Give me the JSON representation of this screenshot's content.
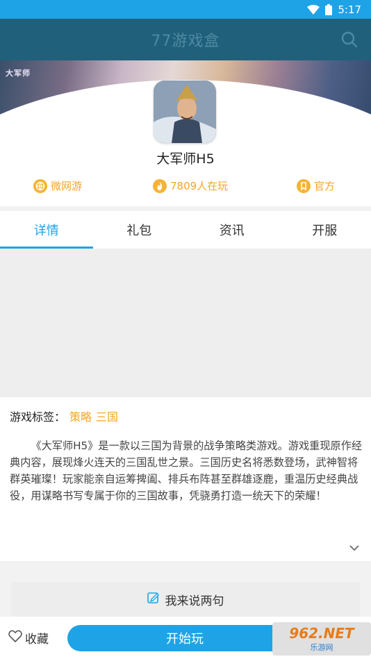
{
  "status_bar": {
    "time": "5:17"
  },
  "header": {
    "title": "77游戏盒"
  },
  "banner": {
    "brand_text": "大军师"
  },
  "game": {
    "name": "大军师H5",
    "meta": [
      {
        "icon": "globe-icon",
        "label": "微网游"
      },
      {
        "icon": "fire-icon",
        "label": "7809人在玩"
      },
      {
        "icon": "bookmark-icon",
        "label": "官方"
      }
    ]
  },
  "tabs": [
    {
      "label": "详情",
      "active": true
    },
    {
      "label": "礼包",
      "active": false
    },
    {
      "label": "资讯",
      "active": false
    },
    {
      "label": "开服",
      "active": false
    }
  ],
  "details": {
    "tags_label": "游戏标签：",
    "tags": [
      "策略",
      "三国"
    ],
    "description": "《大军师H5》是一款以三国为背景的战争策略类游戏。游戏重现原作经典内容，展现烽火连天的三国乱世之景。三国历史名将悉数登场，武神智将群英璀璨！玩家能亲自运筹捭阖、排兵布阵甚至群雄逐鹿，重温历史经典战役，用谋略书写专属于你的三国故事，凭骁勇打造一统天下的荣耀！"
  },
  "comment": {
    "label": "我来说两句"
  },
  "bottom_bar": {
    "favorite_label": "收藏",
    "start_label": "开始玩"
  },
  "watermark": {
    "line1": "962.NET",
    "line2": "乐游网"
  },
  "colors": {
    "accent": "#1ea3e6",
    "orange": "#f5a623",
    "header_bg": "#21607a"
  }
}
